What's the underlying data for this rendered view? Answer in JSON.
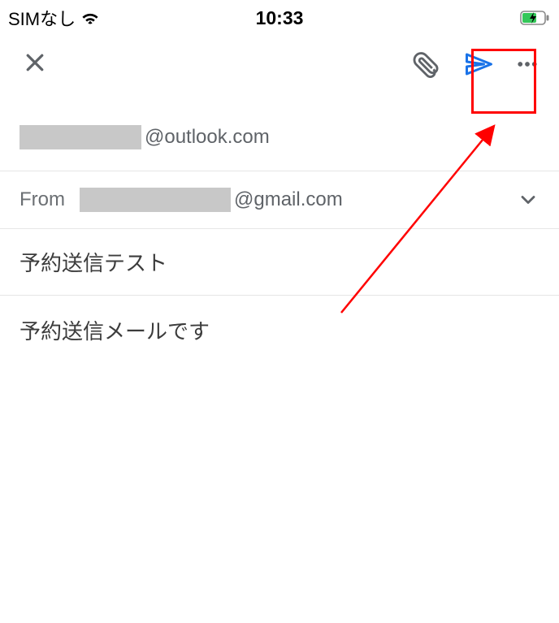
{
  "status": {
    "carrier": "SIMなし",
    "time": "10:33"
  },
  "toolbar": {
    "close": "close",
    "attach": "attach",
    "send": "send",
    "more": "more"
  },
  "compose": {
    "to_domain": "@outlook.com",
    "from_label": "From",
    "from_domain": "@gmail.com",
    "subject": "予約送信テスト",
    "body": "予約送信メールです"
  }
}
